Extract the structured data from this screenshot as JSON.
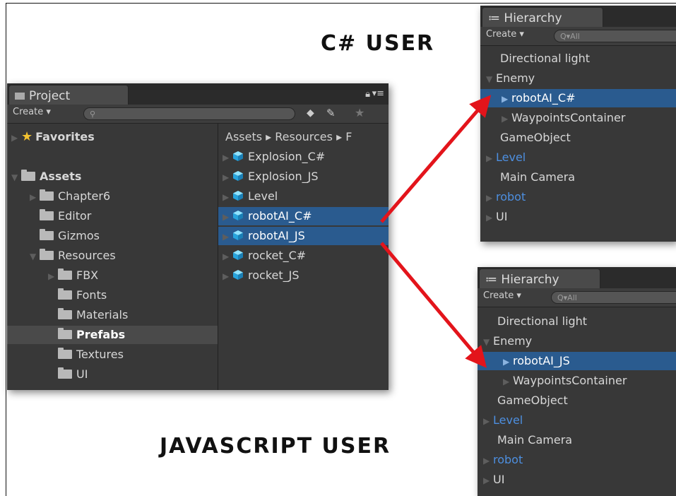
{
  "captions": {
    "csharp": "C# USER",
    "javascript": "JAVASCRIPT USER"
  },
  "project": {
    "tab_label": "Project",
    "create_label": "Create",
    "breadcrumb": "Assets ▸ Resources ▸ F",
    "favorites": "Favorites",
    "tree": [
      {
        "label": "Assets"
      },
      {
        "label": "Chapter6"
      },
      {
        "label": "Editor"
      },
      {
        "label": "Gizmos"
      },
      {
        "label": "Resources"
      },
      {
        "label": "FBX"
      },
      {
        "label": "Fonts"
      },
      {
        "label": "Materials"
      },
      {
        "label": "Prefabs"
      },
      {
        "label": "Textures"
      },
      {
        "label": "UI"
      }
    ],
    "files": [
      {
        "label": "Explosion_C#"
      },
      {
        "label": "Explosion_JS"
      },
      {
        "label": "Level"
      },
      {
        "label": "robotAI_C#"
      },
      {
        "label": "robotAI_JS"
      },
      {
        "label": "rocket_C#"
      },
      {
        "label": "rocket_JS"
      }
    ]
  },
  "hierarchy_cs": {
    "tab_label": "Hierarchy",
    "create_label": "Create",
    "search_placeholder": "Q▾All",
    "items": [
      {
        "label": "Directional light"
      },
      {
        "label": "Enemy"
      },
      {
        "label": "robotAI_C#"
      },
      {
        "label": "WaypointsContainer"
      },
      {
        "label": "GameObject"
      },
      {
        "label": "Level"
      },
      {
        "label": "Main Camera"
      },
      {
        "label": "robot"
      },
      {
        "label": "UI"
      }
    ]
  },
  "hierarchy_js": {
    "tab_label": "Hierarchy",
    "create_label": "Create",
    "search_placeholder": "Q▾All",
    "items": [
      {
        "label": "Directional light"
      },
      {
        "label": "Enemy"
      },
      {
        "label": "robotAI_JS"
      },
      {
        "label": "WaypointsContainer"
      },
      {
        "label": "GameObject"
      },
      {
        "label": "Level"
      },
      {
        "label": "Main Camera"
      },
      {
        "label": "robot"
      },
      {
        "label": "UI"
      }
    ]
  },
  "colors": {
    "selection": "#2a5b8f",
    "prefab_blue": "#4d8fe0",
    "arrow_red": "#e3141b",
    "panel_bg": "#383838"
  }
}
